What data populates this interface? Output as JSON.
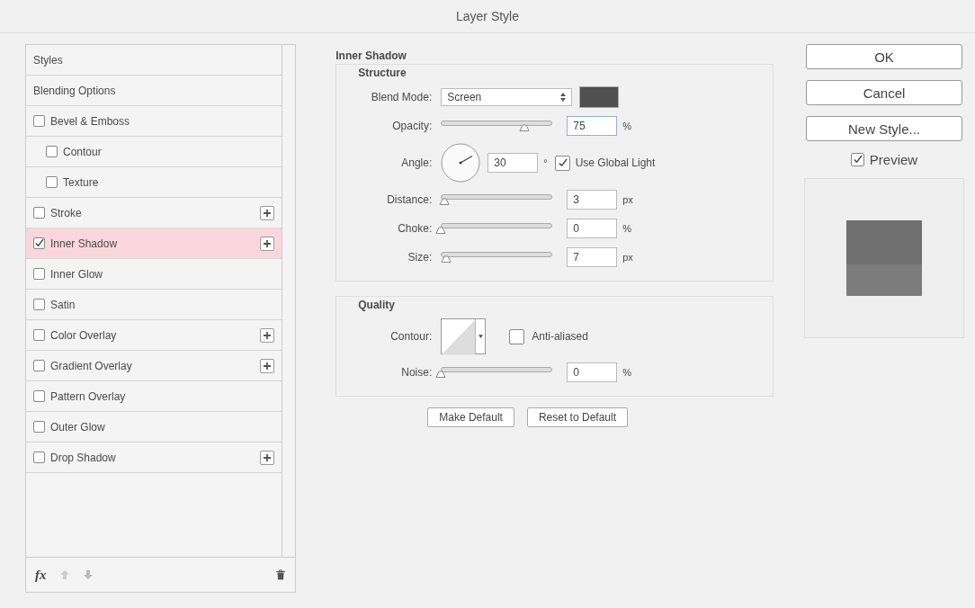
{
  "window": {
    "title": "Layer Style"
  },
  "styles_list": {
    "items": [
      {
        "label": "Styles",
        "kind": "header",
        "selected": false
      },
      {
        "label": "Blending Options",
        "kind": "header",
        "selected": false
      },
      {
        "label": "Bevel & Emboss",
        "kind": "effect",
        "checked": false,
        "selected": false,
        "addable": false,
        "children": [
          {
            "label": "Contour",
            "kind": "effect",
            "checked": false,
            "selected": false,
            "addable": false
          },
          {
            "label": "Texture",
            "kind": "effect",
            "checked": false,
            "selected": false,
            "addable": false
          }
        ]
      },
      {
        "label": "Stroke",
        "kind": "effect",
        "checked": false,
        "selected": false,
        "addable": true
      },
      {
        "label": "Inner Shadow",
        "kind": "effect",
        "checked": true,
        "selected": true,
        "addable": true
      },
      {
        "label": "Inner Glow",
        "kind": "effect",
        "checked": false,
        "selected": false,
        "addable": false
      },
      {
        "label": "Satin",
        "kind": "effect",
        "checked": false,
        "selected": false,
        "addable": false
      },
      {
        "label": "Color Overlay",
        "kind": "effect",
        "checked": false,
        "selected": false,
        "addable": true
      },
      {
        "label": "Gradient Overlay",
        "kind": "effect",
        "checked": false,
        "selected": false,
        "addable": true
      },
      {
        "label": "Pattern Overlay",
        "kind": "effect",
        "checked": false,
        "selected": false,
        "addable": false
      },
      {
        "label": "Outer Glow",
        "kind": "effect",
        "checked": false,
        "selected": false,
        "addable": false
      },
      {
        "label": "Drop Shadow",
        "kind": "effect",
        "checked": false,
        "selected": false,
        "addable": true
      }
    ],
    "toolbar": {
      "fx_label": "fx"
    }
  },
  "panel": {
    "title": "Inner Shadow",
    "structure": {
      "title": "Structure",
      "blend_mode": {
        "label": "Blend Mode:",
        "value": "Screen"
      },
      "rows": [
        {
          "kind": "slider",
          "label": "Opacity:",
          "level": 0.75,
          "value": "75",
          "unit": "%"
        },
        {
          "kind": "angle",
          "label": "Angle:",
          "value": "30",
          "unit": "°",
          "global_light": {
            "label": "Use Global Light",
            "checked": true
          }
        },
        {
          "kind": "slider",
          "label": "Distance:",
          "level": 0.03,
          "value": "3",
          "unit": "px"
        },
        {
          "kind": "slider",
          "label": "Choke:",
          "level": 0,
          "value": "0",
          "unit": "%"
        },
        {
          "kind": "slider",
          "label": "Size:",
          "level": 0.05,
          "value": "7",
          "unit": "px"
        }
      ]
    },
    "quality": {
      "title": "Quality",
      "contour": {
        "label": "Contour:"
      },
      "anti_aliased": {
        "label": "Anti-aliased",
        "checked": false
      },
      "noise": {
        "label": "Noise:",
        "level": 0,
        "value": "0",
        "unit": "%"
      }
    },
    "buttons": [
      "Make Default",
      "Reset to Default"
    ]
  },
  "side": {
    "buttons": [
      "OK",
      "Cancel",
      "New Style..."
    ],
    "preview": {
      "label": "Preview",
      "checked": true
    }
  }
}
